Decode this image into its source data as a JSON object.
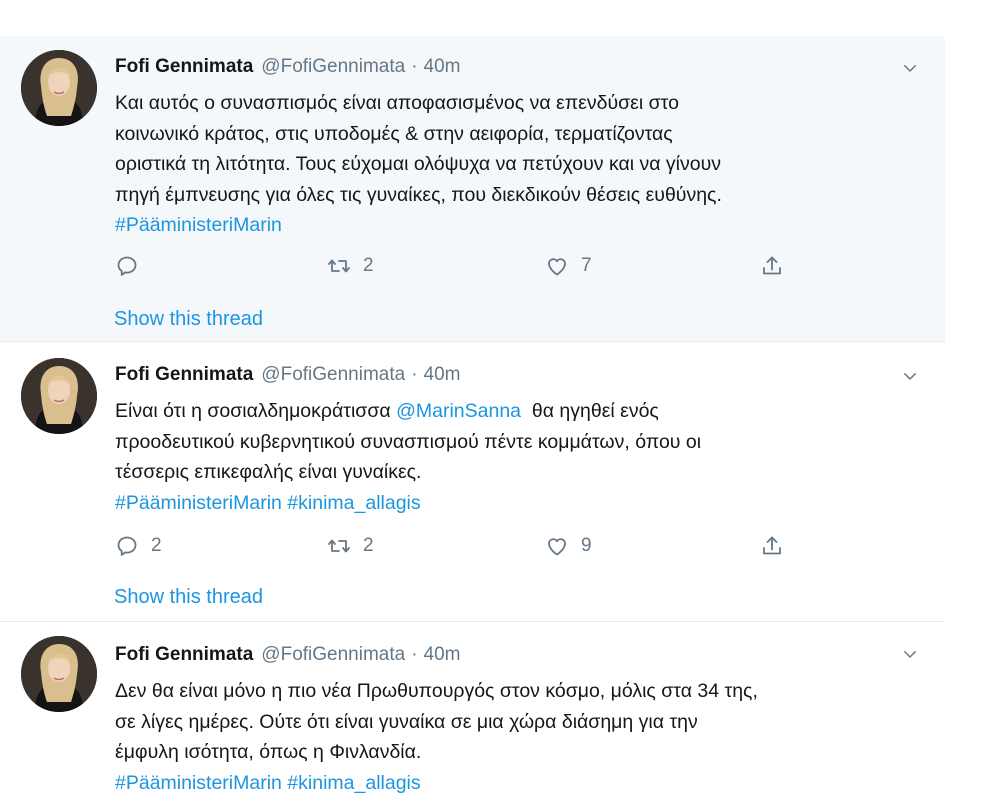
{
  "tweets": [
    {
      "name": "Fofi Gennimata",
      "handle": "@FofiGennimata",
      "sep": "·",
      "time": "40m",
      "lines": [
        "Και αυτός ο συνασπισμός είναι αποφασισμένος να επενδύσει στο",
        "κοινωνικό κράτος, στις υποδομές & στην αειφορία, τερματίζοντας",
        "οριστικά τη λιτότητα. Τους εύχομαι ολόψυχα να πετύχουν και να γίνουν",
        "πηγή έμπνευσης για όλες τις γυναίκες, που διεκδικούν θέσεις ευθύνης."
      ],
      "hashtags": "#PääministeriMarin",
      "replies": "",
      "retweets": "2",
      "likes": "7",
      "show_thread": "Show this thread"
    },
    {
      "name": "Fofi Gennimata",
      "handle": "@FofiGennimata",
      "sep": "·",
      "time": "40m",
      "line1_pre": "Είναι ότι η σοσιαλδημοκράτισσα ",
      "line1_mention": "@MarinSanna",
      "line1_post": "  θα ηγηθεί ενός",
      "lines": [
        "προοδευτικού κυβερνητικού συνασπισμού πέντε κομμάτων, όπου οι",
        "τέσσερις επικεφαλής είναι γυναίκες."
      ],
      "hashtags": "#PääministeriMarin #kinima_allagis",
      "replies": "2",
      "retweets": "2",
      "likes": "9",
      "show_thread": "Show this thread"
    },
    {
      "name": "Fofi Gennimata",
      "handle": "@FofiGennimata",
      "sep": "·",
      "time": "40m",
      "lines": [
        "Δεν θα είναι μόνο η πιο νέα Πρωθυπουργός στον κόσμο, μόλις στα 34 της,",
        "σε λίγες ημέρες. Ούτε ότι είναι γυναίκα σε μια χώρα διάσημη για την",
        "έμφυλη ισότητα, όπως η Φινλανδία."
      ],
      "hashtags": "#PääministeriMarin #kinima_allagis"
    }
  ],
  "colors": {
    "link": "#1b95e0",
    "muted": "#657786",
    "highlight_bg": "#f5f8fa"
  },
  "icons": [
    "reply-icon",
    "retweet-icon",
    "like-icon",
    "share-icon",
    "chevron-down-icon"
  ]
}
